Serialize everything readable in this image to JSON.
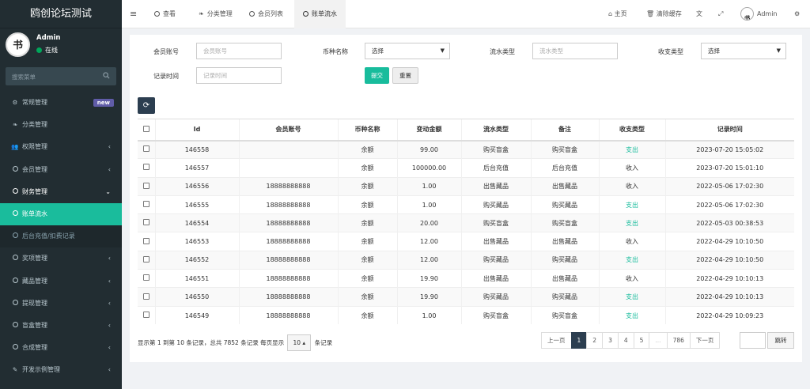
{
  "app": {
    "title": "鸥创论坛测试"
  },
  "user": {
    "name": "Admin",
    "status": "在线"
  },
  "sidebar": {
    "search_placeholder": "搜索菜单",
    "items": [
      {
        "label": "常规管理",
        "icon": "cogs-icon",
        "badge": "new"
      },
      {
        "label": "分类管理",
        "icon": "leaf-icon"
      },
      {
        "label": "权限管理",
        "icon": "users-icon"
      },
      {
        "label": "会员管理",
        "icon": "circle-icon"
      },
      {
        "label": "财务管理",
        "icon": "circle-icon"
      },
      {
        "label": "账单流水",
        "icon": "circle-icon"
      },
      {
        "label": "后台充值/扣费记录",
        "icon": "circle-icon"
      },
      {
        "label": "奖项管理",
        "icon": "circle-icon"
      },
      {
        "label": "藏品管理",
        "icon": "circle-icon"
      },
      {
        "label": "提现管理",
        "icon": "circle-icon"
      },
      {
        "label": "盲盒管理",
        "icon": "circle-icon"
      },
      {
        "label": "合成管理",
        "icon": "circle-icon"
      },
      {
        "label": "开发示例管理",
        "icon": "magic-icon"
      }
    ]
  },
  "topbar": {
    "tabs": [
      {
        "label": "查看"
      },
      {
        "label": "分类管理"
      },
      {
        "label": "会员列表"
      },
      {
        "label": "账单流水"
      }
    ],
    "home": "主页",
    "clear_cache": "清除缓存",
    "user": "Admin"
  },
  "filters": {
    "member_label": "会员账号",
    "member_placeholder": "会员账号",
    "currency_label": "币种名称",
    "currency_value": "选择",
    "flow_label": "流水类型",
    "flow_placeholder": "流水类型",
    "io_label": "收支类型",
    "io_value": "选择",
    "time_label": "记录时间",
    "time_placeholder": "记录时间",
    "submit": "提交",
    "reset": "重置"
  },
  "table": {
    "headers": [
      "Id",
      "会员账号",
      "币种名称",
      "变动金额",
      "流水类型",
      "备注",
      "收支类型",
      "记录时间"
    ],
    "rows": [
      {
        "id": "146558",
        "member": "",
        "currency": "余额",
        "amount": "99.00",
        "flow": "购买盲盒",
        "note": "购买盲盒",
        "io": "支出",
        "time": "2023-07-20 15:05:02"
      },
      {
        "id": "146557",
        "member": "",
        "currency": "余额",
        "amount": "100000.00",
        "flow": "后台充值",
        "note": "后台充值",
        "io": "收入",
        "time": "2023-07-20 15:01:10"
      },
      {
        "id": "146556",
        "member": "18888888888",
        "currency": "余额",
        "amount": "1.00",
        "flow": "出售藏品",
        "note": "出售藏品",
        "io": "收入",
        "time": "2022-05-06 17:02:30"
      },
      {
        "id": "146555",
        "member": "18888888888",
        "currency": "余额",
        "amount": "1.00",
        "flow": "购买藏品",
        "note": "购买藏品",
        "io": "支出",
        "time": "2022-05-06 17:02:30"
      },
      {
        "id": "146554",
        "member": "18888888888",
        "currency": "余额",
        "amount": "20.00",
        "flow": "购买盲盒",
        "note": "购买盲盒",
        "io": "支出",
        "time": "2022-05-03 00:38:53"
      },
      {
        "id": "146553",
        "member": "18888888888",
        "currency": "余额",
        "amount": "12.00",
        "flow": "出售藏品",
        "note": "出售藏品",
        "io": "收入",
        "time": "2022-04-29 10:10:50"
      },
      {
        "id": "146552",
        "member": "18888888888",
        "currency": "余额",
        "amount": "12.00",
        "flow": "购买藏品",
        "note": "购买藏品",
        "io": "支出",
        "time": "2022-04-29 10:10:50"
      },
      {
        "id": "146551",
        "member": "18888888888",
        "currency": "余额",
        "amount": "19.90",
        "flow": "出售藏品",
        "note": "出售藏品",
        "io": "收入",
        "time": "2022-04-29 10:10:13"
      },
      {
        "id": "146550",
        "member": "18888888888",
        "currency": "余额",
        "amount": "19.90",
        "flow": "购买藏品",
        "note": "购买藏品",
        "io": "支出",
        "time": "2022-04-29 10:10:13"
      },
      {
        "id": "146549",
        "member": "18888888888",
        "currency": "余额",
        "amount": "1.00",
        "flow": "购买盲盒",
        "note": "购买盲盒",
        "io": "支出",
        "time": "2022-04-29 10:09:23"
      }
    ]
  },
  "pagination": {
    "info_prefix": "显示第 1 到第 10 条记录，总共 7852 条记录 每页显示",
    "page_size": "10",
    "info_suffix": "条记录",
    "prev": "上一页",
    "pages": [
      "1",
      "2",
      "3",
      "4",
      "5",
      "...",
      "786"
    ],
    "next": "下一页",
    "jump": "跳转"
  },
  "colors": {
    "accent": "#18bc9c",
    "sidebar": "#222d32",
    "active_page": "#2c3e50",
    "badge": "#605ca8"
  }
}
